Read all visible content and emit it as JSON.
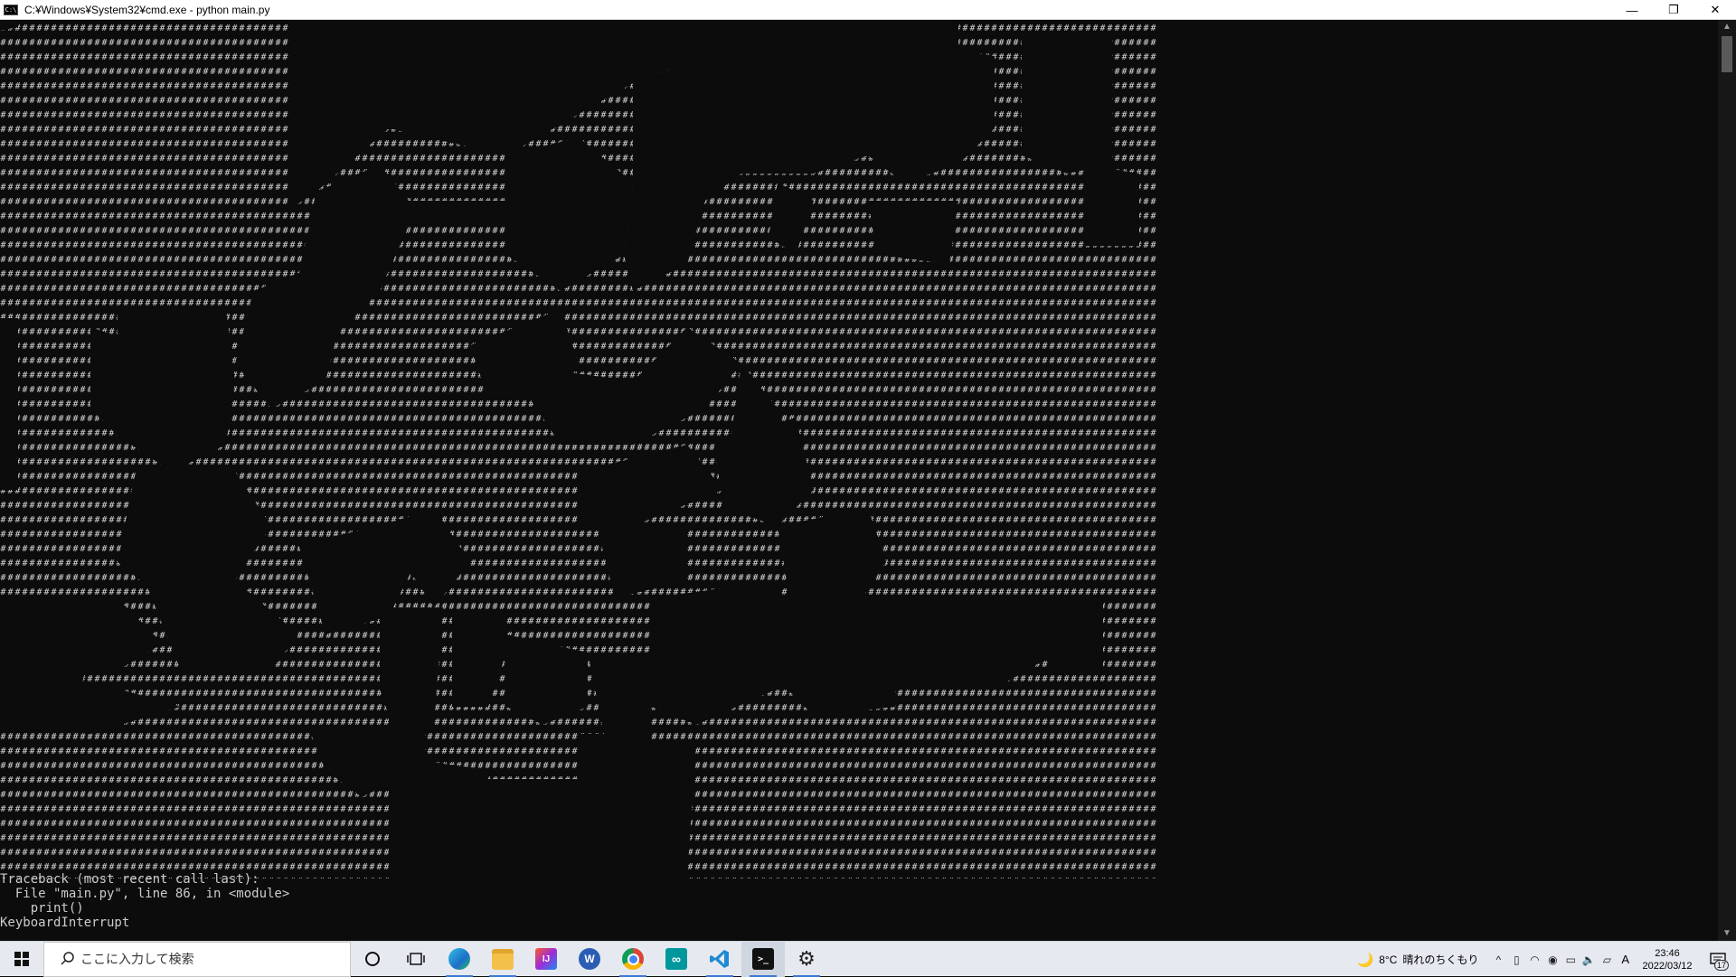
{
  "window": {
    "title": "C:¥Windows¥System32¥cmd.exe - python  main.py",
    "controls": {
      "minimize": "—",
      "maximize": "❐",
      "close": "✕"
    }
  },
  "console": {
    "output": "Traceback (most recent call last):\n  File \"main.py\", line 86, in <module>\n    print()\nKeyboardInterrupt",
    "art_glyph": "#",
    "colors": {
      "background": "#0c0c0c",
      "text": "#cccccc"
    }
  },
  "taskbar": {
    "search_placeholder": "ここに入力して検索",
    "apps": [
      {
        "name": "cortana",
        "label": ""
      },
      {
        "name": "task-view",
        "label": ""
      },
      {
        "name": "edge",
        "label": ""
      },
      {
        "name": "file-explorer",
        "label": ""
      },
      {
        "name": "intellij",
        "label": "IJ"
      },
      {
        "name": "word",
        "label": "W"
      },
      {
        "name": "chrome",
        "label": ""
      },
      {
        "name": "arduino",
        "label": "∞"
      },
      {
        "name": "vscode",
        "label": ""
      },
      {
        "name": "terminal",
        "label": ">_"
      },
      {
        "name": "settings",
        "label": "⚙"
      }
    ],
    "weather": {
      "temp": "8°C",
      "condition": "晴れのちくもり"
    },
    "ime": "A",
    "clock": {
      "time": "23:46",
      "date": "2022/03/12"
    },
    "notifications_count": "17"
  }
}
